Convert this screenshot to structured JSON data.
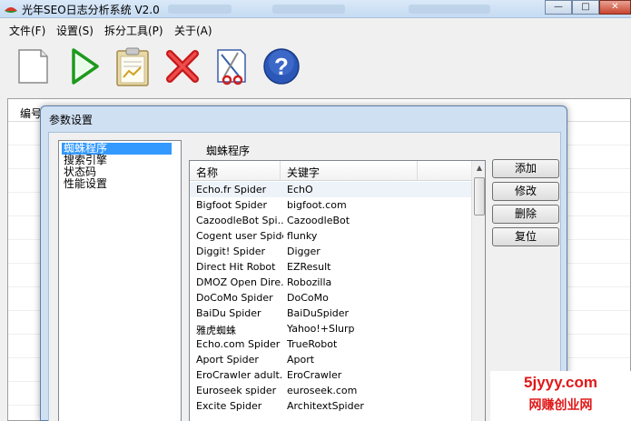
{
  "app": {
    "title": "光年SEO日志分析系统 V2.0"
  },
  "window_controls": {
    "minimize": "—",
    "maximize": "□",
    "close": "✕"
  },
  "menu": {
    "items": [
      "文件(F)",
      "设置(S)",
      "拆分工具(P)",
      "关于(A)"
    ]
  },
  "toolbar": {
    "icons": [
      "new-file-icon",
      "run-icon",
      "clipboard-report-icon",
      "delete-icon",
      "split-tool-icon",
      "help-icon"
    ]
  },
  "background_list": {
    "header": "编号"
  },
  "dialog": {
    "title": "参数设置",
    "tree": {
      "items": [
        "蜘蛛程序",
        "搜索引擎",
        "状态码",
        "性能设置"
      ],
      "selected": "蜘蛛程序"
    },
    "section_label": "蜘蛛程序",
    "table": {
      "columns": [
        "名称",
        "关键字"
      ],
      "rows": [
        [
          "Echo.fr Spider",
          "EchO"
        ],
        [
          "Bigfoot Spider",
          "bigfoot.com"
        ],
        [
          "CazoodleBot Spi...",
          "CazoodleBot"
        ],
        [
          "Cogent user Spider",
          "flunky"
        ],
        [
          "Diggit! Spider",
          "Digger"
        ],
        [
          "Direct Hit Robot",
          "EZResult"
        ],
        [
          "DMOZ Open Dire...",
          "Robozilla"
        ],
        [
          "DoCoMo Spider",
          "DoCoMo"
        ],
        [
          "BaiDu Spider",
          "BaiDuSpider"
        ],
        [
          "雅虎蜘蛛",
          "Yahoo!+Slurp"
        ],
        [
          "Echo.com Spider",
          "TrueRobot"
        ],
        [
          "Aport Spider",
          "Aport"
        ],
        [
          "EroCrawler adult...",
          "EroCrawler"
        ],
        [
          "Euroseek spider",
          "euroseek.com"
        ],
        [
          "Excite Spider",
          "ArchitextSpider"
        ]
      ]
    },
    "buttons": {
      "add": "添加",
      "edit": "修改",
      "delete": "删除",
      "reset": "复位"
    }
  },
  "watermark": {
    "line1": "5jyyy.com",
    "line2": "网赚创业网",
    "color": "#e01818"
  },
  "colors": {
    "selection": "#3399ff",
    "dialog_frame": "#cfe0f3"
  }
}
